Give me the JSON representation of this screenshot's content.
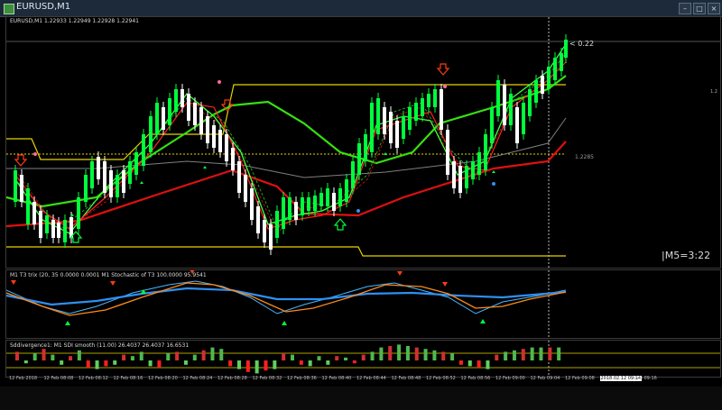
{
  "window": {
    "title": "EURUSD,M1",
    "icon": "chart-icon"
  },
  "main": {
    "header": "EURUSD,M1  1.22933 1.22949 1.22928 1.22941",
    "price_marker": "< 0.22",
    "level_label": "1.2285",
    "timer": "|M5=3:22",
    "right_value": "1.2"
  },
  "indicator1": {
    "header": "M1 T3 trix (20, 35 0.0000 0.0001  M1   Stochastic of T3 100.0000 95.9541"
  },
  "indicator2": {
    "header": "Sddivergence1:  M1   SDI smooth (11.00) 26.4037 26.4037 16.6531"
  },
  "xaxis": {
    "ticks": [
      "12 Feb 2018",
      "12 Feb 08:08",
      "12 Feb 08:12",
      "12 Feb 08:16",
      "12 Feb 08:20",
      "12 Feb 08:24",
      "12 Feb 08:28",
      "12 Feb 08:32",
      "12 Feb 08:36",
      "12 Feb 08:40",
      "12 Feb 08:44",
      "12 Feb 08:48",
      "12 Feb 08:52",
      "12 Feb 08:56",
      "12 Feb 09:00",
      "12 Feb 09:04",
      "12 Feb 09:08",
      "2018.02.12 09:14",
      "Feb 09:16"
    ],
    "highlight": "2018.02.12 09:14"
  },
  "colors": {
    "bull": "#00ff3c",
    "bear": "#ffffff",
    "green_line": "#36e010",
    "red_line": "#e01010",
    "yellow": "#e6d400",
    "gray": "#7f7f7f",
    "blue": "#2f8ff0",
    "orange": "#ff8a1a",
    "arrow": "#ff3b12"
  }
}
